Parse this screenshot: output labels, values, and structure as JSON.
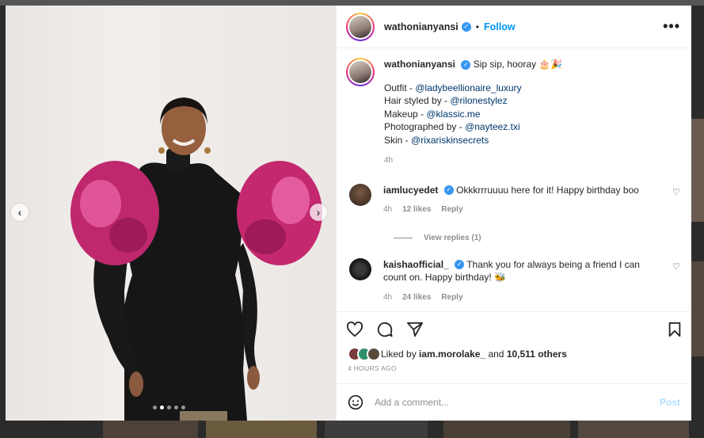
{
  "post": {
    "username": "wathonianyansi",
    "follow_label": "Follow",
    "separator": "•",
    "more_icon": "more-horizontal-icon"
  },
  "caption": {
    "username": "wathonianyansi",
    "text": "Sip sip, hooray 🎂🎉",
    "credits": [
      {
        "label": "Outfit - ",
        "handle": "@ladybeellionaire_luxury"
      },
      {
        "label": "Hair styled by - ",
        "handle": "@rilonestylez"
      },
      {
        "label": "Makeup - ",
        "handle": "@klassic.me"
      },
      {
        "label": "Photographed by - ",
        "handle": "@nayteez.txi"
      },
      {
        "label": "Skin - ",
        "handle": "@rixariskinsecrets"
      }
    ],
    "time": "4h"
  },
  "comments": [
    {
      "username": "iamlucyedet",
      "text": "Okkkrrruuuu here for it! Happy birthday boo",
      "time": "4h",
      "likes": "12 likes",
      "reply": "Reply",
      "view_replies": "View replies (1)"
    },
    {
      "username": "kaishaofficial_",
      "text": "Thank you for always being a friend I can count on. Happy birthday! 🐝",
      "time": "4h",
      "likes": "24 likes",
      "reply": "Reply"
    }
  ],
  "likes": {
    "prefix": "Liked by",
    "user": "iam.morolake_",
    "and": "and",
    "others": "10,511 others",
    "posted": "4 HOURS AGO"
  },
  "composer": {
    "placeholder": "Add a comment...",
    "post_label": "Post"
  },
  "carousel": {
    "slide_count": 5,
    "active_index": 1
  },
  "colors": {
    "accent": "#0095f6",
    "verified": "#3897f0",
    "link": "#00376b",
    "muted": "#8e8e8e"
  }
}
